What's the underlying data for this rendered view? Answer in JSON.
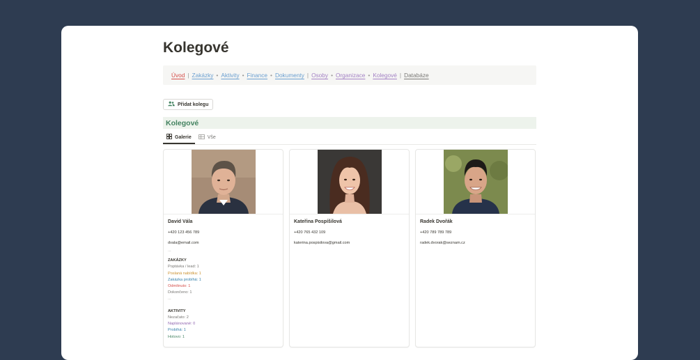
{
  "page": {
    "title": "Kolegové"
  },
  "nav": {
    "items": [
      {
        "label": "Úvod",
        "color": "#d44c47"
      },
      {
        "label": "Zakázky",
        "color": "#6a9fd0"
      },
      {
        "label": "Aktivity",
        "color": "#6a9fd0"
      },
      {
        "label": "Finance",
        "color": "#6a9fd0"
      },
      {
        "label": "Dokumenty",
        "color": "#6a9fd0"
      },
      {
        "label": "Osoby",
        "color": "#a381c4"
      },
      {
        "label": "Organizace",
        "color": "#a381c4"
      },
      {
        "label": "Kolegové",
        "color": "#a381c4"
      },
      {
        "label": "Databáze",
        "color": "#787774"
      }
    ]
  },
  "toolbar": {
    "add_label": "Přidat kolegu",
    "add_icon": "people-icon"
  },
  "section": {
    "title": "Kolegové"
  },
  "tabs": [
    {
      "label": "Galerie",
      "icon": "gallery-icon",
      "active": true
    },
    {
      "label": "Vše",
      "icon": "table-icon",
      "active": false
    }
  ],
  "cards": [
    {
      "name": "David Vála",
      "phone": "+420 123 456 789",
      "email": "dvala@email.com",
      "ellipsis": "...",
      "zakazky_title": "ZAKÁZKY",
      "zakazky": [
        {
          "text": "Poptávka / lead: 1",
          "color": "#787774"
        },
        {
          "text": "Poslaná nabídka: 1",
          "color": "#cb912f"
        },
        {
          "text": "Zakázka probíhá: 1",
          "color": "#337ea9"
        },
        {
          "text": "Odmítnuto: 1",
          "color": "#d44c47"
        },
        {
          "text": "Dokončeno: 1",
          "color": "#787774"
        }
      ],
      "zakazky_more": "...",
      "aktivity_title": "AKTIVITY",
      "aktivity": [
        {
          "text": "Nezačato: 2",
          "color": "#787774"
        },
        {
          "text": "Naplánované: 0",
          "color": "#9065b0"
        },
        {
          "text": "Probíhá: 1",
          "color": "#337ea9"
        },
        {
          "text": "Hotovo: 1",
          "color": "#448361"
        }
      ]
    },
    {
      "name": "Kateřina Pospíšilová",
      "phone": "+420 765 432 109",
      "email": "katerina.pospisilova@gmail.com"
    },
    {
      "name": "Radek Dvořák",
      "phone": "+420 789 789 789",
      "email": "radek.dvorak@seznam.cz"
    }
  ]
}
